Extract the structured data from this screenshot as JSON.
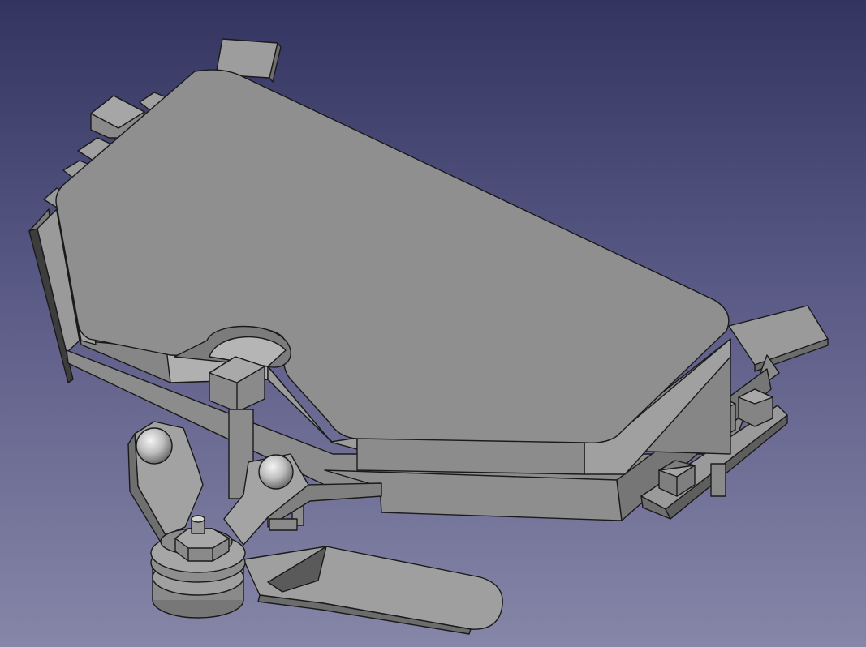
{
  "viewport": {
    "background_top": "#343460",
    "background_bottom": "#8686a8",
    "model_face_color": "#8f8f8f",
    "model_edge_color": "#1a1a1a"
  }
}
